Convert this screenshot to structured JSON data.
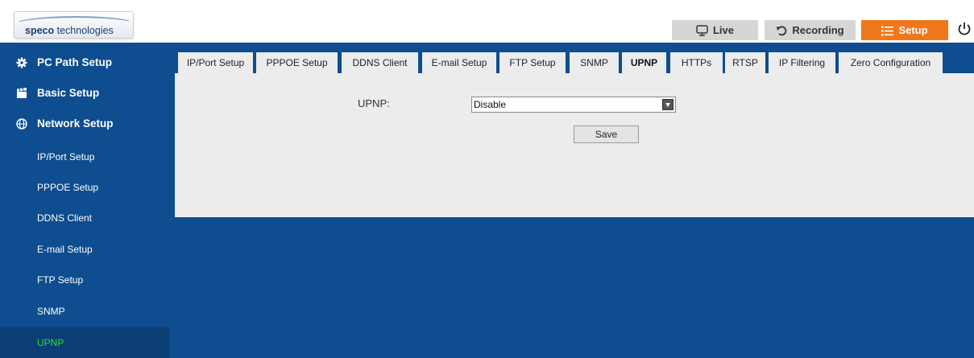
{
  "header": {
    "logo_bold": "speco",
    "logo_light": " technologies",
    "nav": {
      "live": "Live",
      "recording": "Recording",
      "setup": "Setup"
    }
  },
  "sidebar": {
    "main_items": [
      {
        "label": "PC Path Setup",
        "icon": "gear-icon"
      },
      {
        "label": "Basic Setup",
        "icon": "clapperboard-icon"
      },
      {
        "label": "Network Setup",
        "icon": "network-globe-icon"
      }
    ],
    "sub_items": [
      {
        "label": "IP/Port Setup"
      },
      {
        "label": "PPPOE Setup"
      },
      {
        "label": "DDNS Client"
      },
      {
        "label": "E-mail Setup"
      },
      {
        "label": "FTP Setup"
      },
      {
        "label": "SNMP"
      },
      {
        "label": "UPNP"
      }
    ],
    "active_sub": "UPNP"
  },
  "tabs": [
    {
      "label": "IP/Port Setup"
    },
    {
      "label": "PPPOE Setup"
    },
    {
      "label": "DDNS Client"
    },
    {
      "label": "E-mail Setup"
    },
    {
      "label": "FTP Setup"
    },
    {
      "label": "SNMP"
    },
    {
      "label": "UPNP"
    },
    {
      "label": "HTTPs"
    },
    {
      "label": "RTSP"
    },
    {
      "label": "IP Filtering"
    },
    {
      "label": "Zero Configuration"
    }
  ],
  "active_tab": "UPNP",
  "form": {
    "upnp_label": "UPNP:",
    "upnp_value": "Disable",
    "save_label": "Save"
  },
  "colors": {
    "brand_blue": "#0e4d8f",
    "setup_orange": "#f1771c",
    "active_green": "#29e035",
    "panel_gray": "#ececec"
  }
}
